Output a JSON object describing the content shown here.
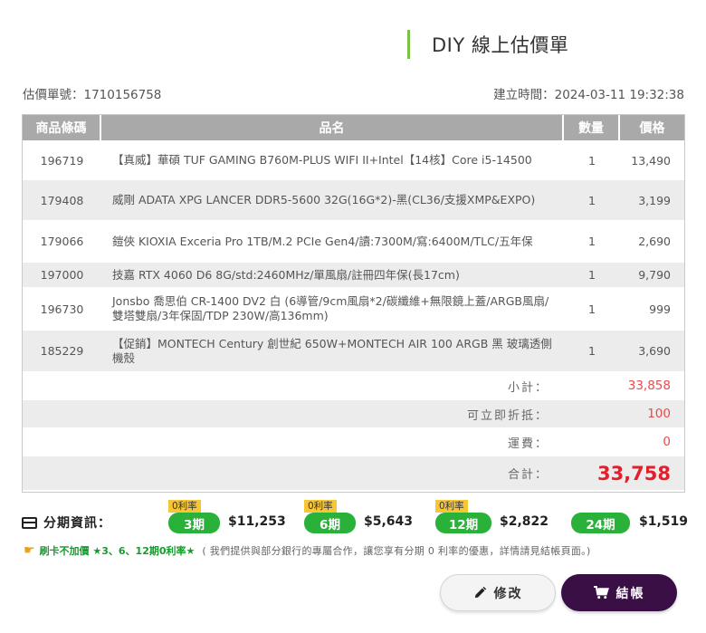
{
  "header": {
    "title": "DIY 線上估價單"
  },
  "meta": {
    "quote_no_label": "估價單號：",
    "quote_no": "1710156758",
    "created_label": "建立時間：",
    "created": "2024-03-11 19:32:38"
  },
  "table": {
    "headers": [
      "商品條碼",
      "品名",
      "數量",
      "價格"
    ],
    "rows": [
      {
        "code": "196719",
        "name": "【真威】華碩 TUF GAMING B760M-PLUS WIFI II+Intel【14核】Core i5-14500",
        "qty": "1",
        "price": "13,490"
      },
      {
        "code": "179408",
        "name": "威剛 ADATA XPG LANCER DDR5-5600 32G(16G*2)-黑(CL36/支援XMP&EXPO)",
        "qty": "1",
        "price": "3,199"
      },
      {
        "code": "179066",
        "name": "鎧俠 KIOXIA Exceria Pro 1TB/M.2 PCIe Gen4/讀:7300M/寫:6400M/TLC/五年保",
        "qty": "1",
        "price": "2,690"
      },
      {
        "code": "197000",
        "name": "技嘉 RTX 4060 D6 8G/std:2460MHz/單風扇/註冊四年保(長17cm)",
        "qty": "1",
        "price": "9,790"
      },
      {
        "code": "196730",
        "name": "Jonsbo 喬思伯 CR-1400 DV2 白 (6導管/9cm風扇*2/碳纖維+無限鏡上蓋/ARGB風扇/雙塔雙扇/3年保固/TDP 230W/高136mm)",
        "qty": "1",
        "price": "999"
      },
      {
        "code": "185229",
        "name": "【促銷】MONTECH Century 創世紀 650W+MONTECH AIR 100 ARGB 黑 玻璃透側機殼",
        "qty": "1",
        "price": "3,690"
      }
    ]
  },
  "summary": {
    "subtotal_label": "小計：",
    "subtotal": "33,858",
    "discount_label": "可立即折抵：",
    "discount": "100",
    "shipping_label": "運費：",
    "shipping": "0",
    "total_label": "合計：",
    "total": "33,758"
  },
  "installments": {
    "label": "分期資訊：",
    "plans": [
      {
        "badge": "0利率",
        "term": "3期",
        "amount": "$11,253"
      },
      {
        "badge": "0利率",
        "term": "6期",
        "amount": "$5,643"
      },
      {
        "badge": "0利率",
        "term": "12期",
        "amount": "$2,822"
      },
      {
        "badge": "",
        "term": "24期",
        "amount": "$1,519"
      }
    ]
  },
  "note": {
    "green": "刷卡不加價 ★3、6、12期0利率★",
    "gray": "( 我們提供與部分銀行的專屬合作，讓您享有分期 0 利率的優惠，詳情請見結帳頁面。)"
  },
  "buttons": {
    "edit": "修改",
    "checkout": "結帳"
  },
  "colors": {
    "accent_green": "#2ab13a",
    "total_red": "#e41e2b",
    "checkout_purple": "#3a0f46",
    "badge_yellow": "#f6c634"
  }
}
